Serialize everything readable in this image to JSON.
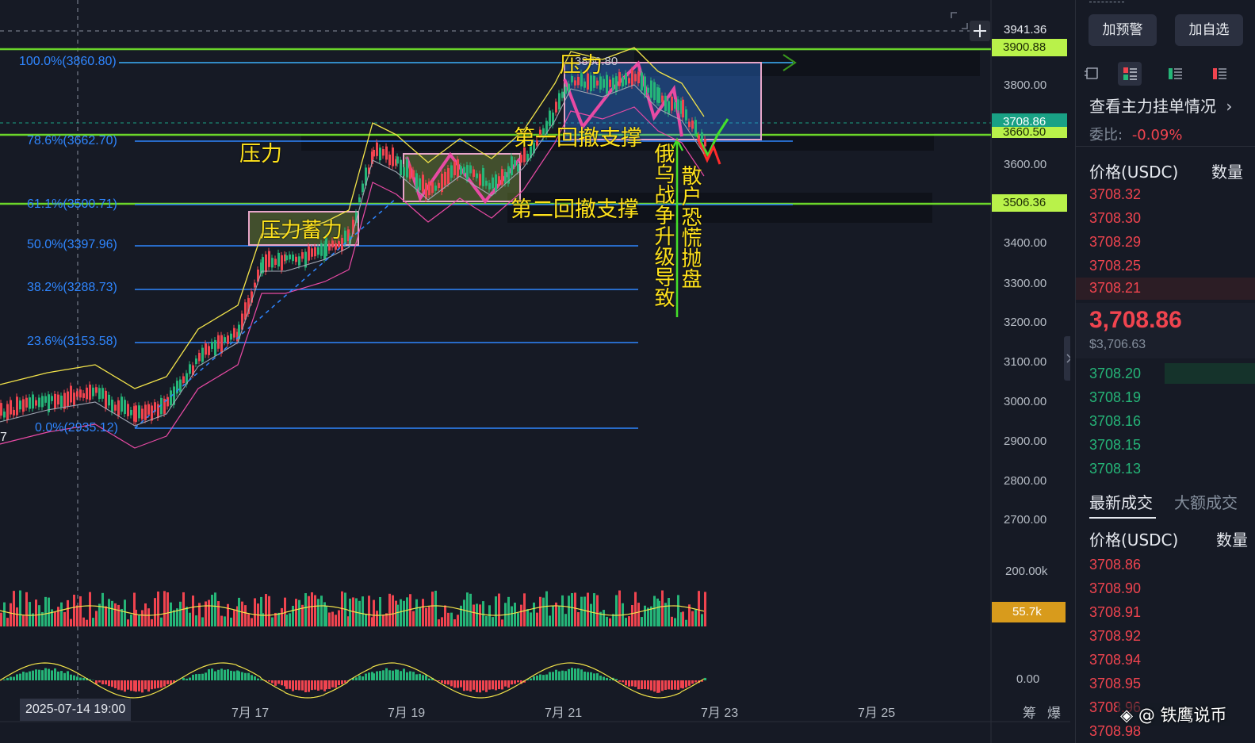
{
  "chart": {
    "last_price_label": "3941.36",
    "price_tags": [
      {
        "label": "3900.88",
        "bg": "#b9f24a",
        "fg": "#1c2b05"
      },
      {
        "label": "3708.86",
        "bg": "#19a185",
        "fg": "#ffffff"
      },
      {
        "label": "3660.50",
        "bg": "#b9f24a",
        "fg": "#1c2b05"
      },
      {
        "label": "3506.36",
        "bg": "#b9f24a",
        "fg": "#1c2b05"
      }
    ],
    "y_axis": [
      "3800.00",
      "3600.00",
      "3400.00",
      "3300.00",
      "3200.00",
      "3100.00",
      "3000.00",
      "2900.00",
      "2800.00",
      "2700.00"
    ],
    "volume_axis": "200.00k",
    "volume_tag": "55.7k",
    "macd_axis": "0.00",
    "fib_levels": [
      {
        "label": "100.0%(3860.80)"
      },
      {
        "label": "78.6%(3662.70)"
      },
      {
        "label": "61.1%(3500.71)"
      },
      {
        "label": "50.0%(3397.96)"
      },
      {
        "label": "38.2%(3288.73)"
      },
      {
        "label": "23.6%(3153.58)"
      },
      {
        "label": "0.0%(2935.12)"
      }
    ],
    "top_box_value": "3860.80",
    "x_axis": {
      "crosshair_time": "2025-07-14 19:00",
      "labels": [
        "7月 17",
        "7月 19",
        "7月 21",
        "7月 23",
        "7月 25"
      ],
      "right_icons": [
        "筹",
        "爆"
      ]
    },
    "left_edge_digit": "7",
    "annotations": {
      "pressure_left": "压力",
      "pressure_top": "压力",
      "pressure_accumulate": "压力蓄力",
      "first_pullback": "第一回撤支撑",
      "second_pullback": "第二回撤支撑",
      "war_note": "俄乌战争升级导致",
      "panic_note": "散户恐慌抛盘"
    }
  },
  "sidebar": {
    "alert_button": "加预警",
    "watchlist_button": "加自选",
    "order_book_link": "查看主力挂单情况",
    "commission_ratio_label": "委比:",
    "commission_ratio_value": "-0.09%",
    "price_header": "价格(USDC)",
    "qty_header": "数量",
    "asks": [
      "3708.32",
      "3708.30",
      "3708.29",
      "3708.25",
      "3708.21"
    ],
    "mid_price": "3,708.86",
    "mid_price_usd": "$3,706.63",
    "bids": [
      "3708.20",
      "3708.19",
      "3708.16",
      "3708.15",
      "3708.13"
    ],
    "tab_latest": "最新成交",
    "tab_large": "大额成交",
    "trades_price_header": "价格(USDC)",
    "trades_qty_header": "数量",
    "trades": [
      "3708.86",
      "3708.90",
      "3708.91",
      "3708.92",
      "3708.94",
      "3708.95",
      "3708.96",
      "3708.98"
    ],
    "watermark": "@ 铁鹰说币"
  },
  "colors": {
    "bg": "#161a25",
    "up": "#25b578",
    "down": "#f0444f",
    "fib": "#2f86ff",
    "annotation": "#ffe21c",
    "pink": "#e84aa4",
    "green_line": "#6bd62a"
  }
}
